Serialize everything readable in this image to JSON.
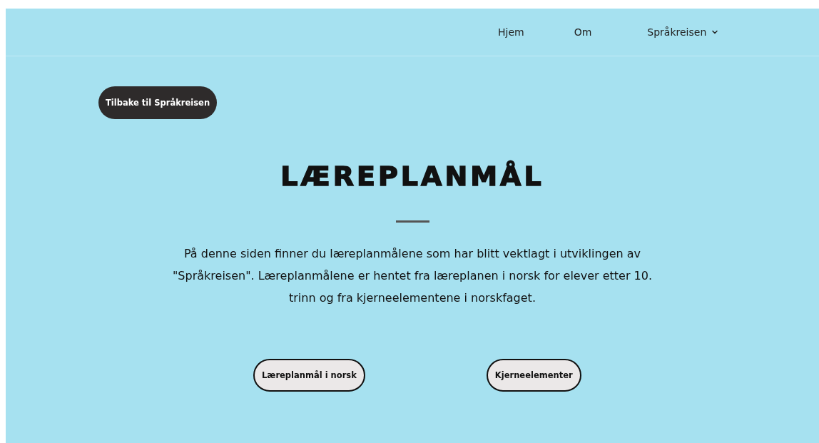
{
  "nav": {
    "items": [
      {
        "label": "Hjem",
        "dropdown": false
      },
      {
        "label": "Om",
        "dropdown": false
      },
      {
        "label": "Språkreisen",
        "dropdown": true
      }
    ]
  },
  "back_button": "Tilbake til Språkreisen",
  "title": "LÆREPLANMÅL",
  "intro": "På denne siden finner du læreplanmålene som har blitt vektlagt i utviklingen av \"Språkreisen\". Læreplanmålene er hentet fra læreplanen i norsk for elever etter 10. trinn og fra kjerneelementene i norskfaget.",
  "buttons": [
    "Læreplanmål i norsk",
    "Kjerneelementer"
  ]
}
